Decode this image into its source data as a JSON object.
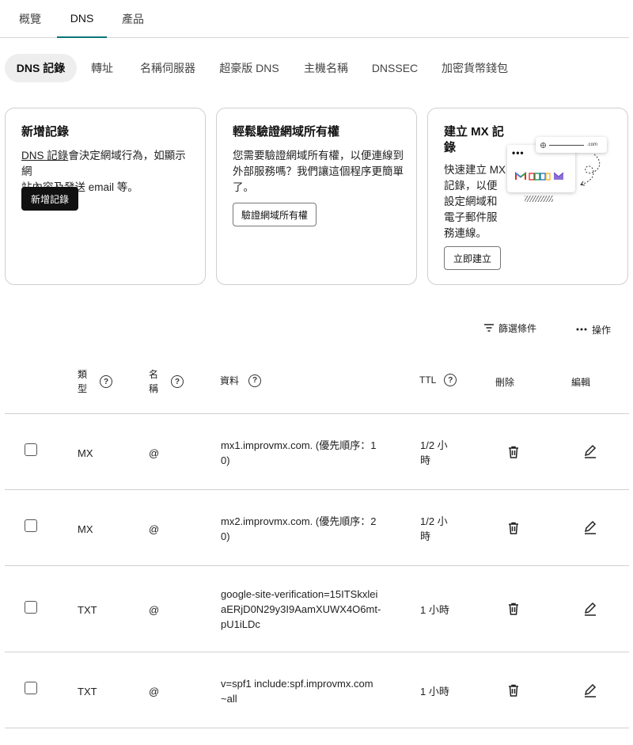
{
  "top_tabs": [
    {
      "label": "概覽"
    },
    {
      "label": "DNS"
    },
    {
      "label": "產品"
    }
  ],
  "sub_tabs": [
    {
      "label": "DNS 記錄"
    },
    {
      "label": "轉址"
    },
    {
      "label": "名稱伺服器"
    },
    {
      "label": "超豪版 DNS"
    },
    {
      "label": "主機名稱"
    },
    {
      "label": "DNSSEC"
    },
    {
      "label": "加密貨幣錢包"
    }
  ],
  "cards": {
    "add_record": {
      "title": "新增記錄",
      "link": "DNS 記錄",
      "desc_line1_rest": "會決定網域行為，如顯示網",
      "desc_line2": "站內容及發送 email 等。",
      "button": "新增記錄"
    },
    "verify": {
      "title": "輕鬆驗證網域所有權",
      "desc_line1": "您需要驗證網域所有權，以便連線到",
      "desc_line2": "外部服務嗎？我們讓這個程序更簡單",
      "desc_line3": "了。",
      "button": "驗證網域所有權"
    },
    "mx": {
      "title_line1": "建立 MX 記",
      "title_line2": "錄",
      "desc_lines": [
        "快速建立 MX",
        "記錄，以便",
        "設定網域和",
        "電子郵件服",
        "務連線。"
      ],
      "button": "立即建立",
      "illustration_bar_text": ".com"
    }
  },
  "toolbar": {
    "filter_label": "篩選條件",
    "actions_label": "操作"
  },
  "table": {
    "headers": {
      "type_line1": "類",
      "type_line2": "型",
      "name_line1": "名",
      "name_line2": "稱",
      "data": "資料",
      "ttl": "TTL",
      "delete": "刪除",
      "edit": "編輯",
      "help_glyph": "?"
    },
    "rows": [
      {
        "type": "MX",
        "name": "@",
        "data_lines": [
          "mx1.improvmx.com. (優先順序：1",
          "0)"
        ],
        "ttl_lines": [
          "1/2 小",
          "時"
        ]
      },
      {
        "type": "MX",
        "name": "@",
        "data_lines": [
          "mx2.improvmx.com. (優先順序：2",
          "0)"
        ],
        "ttl_lines": [
          "1/2 小",
          "時"
        ]
      },
      {
        "type": "TXT",
        "name": "@",
        "data_lines": [
          "google-site-verification=15ITSkxlei",
          "aERjD0N29y3I9AamXUWX4O6mt-",
          "pU1iLDc"
        ],
        "ttl_lines": [
          "1 小時"
        ]
      },
      {
        "type": "TXT",
        "name": "@",
        "data_lines": [
          "v=spf1 include:spf.improvmx.com",
          "~all"
        ],
        "ttl_lines": [
          "1 小時"
        ]
      }
    ]
  },
  "colors": {
    "accent": "#09757a",
    "primary_button": "#111111",
    "border": "#d0d0d0"
  }
}
